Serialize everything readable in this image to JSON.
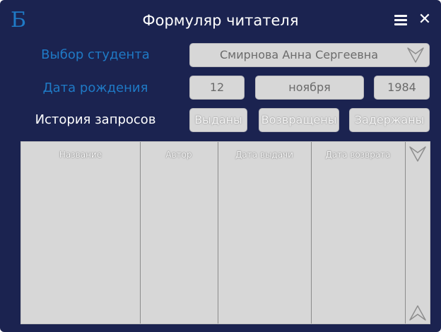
{
  "header": {
    "logo_glyph": "Б",
    "title": "Формуляр читателя",
    "menu_icon": "hamburger-menu-icon",
    "close_icon": "close-icon",
    "close_glyph": "✕"
  },
  "form": {
    "student_label": "Выбор студента",
    "student_value": "Смирнова Анна Сергеевна",
    "birth_label": "Дата рождения",
    "birth_day": "12",
    "birth_month": "ноября",
    "birth_year": "1984",
    "history_label": "История запросов",
    "history_buttons": [
      "Выданы",
      "Возвращены",
      "Задержаны"
    ]
  },
  "table": {
    "columns": [
      "Название",
      "Автор",
      "Дата выдачи",
      "Дата возврата"
    ],
    "rows": []
  },
  "colors": {
    "background": "#1b2350",
    "accent": "#1f7ac6",
    "field": "#d7d7d7"
  }
}
